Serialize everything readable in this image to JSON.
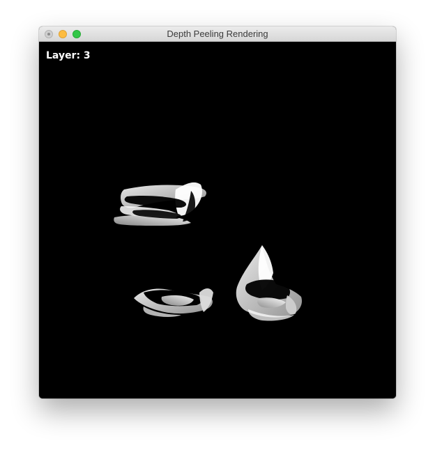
{
  "window": {
    "title": "Depth Peeling Rendering"
  },
  "controls": {
    "close_icon": "close-icon",
    "minimize_icon": "minimize-icon",
    "zoom_icon": "zoom-icon"
  },
  "viewport": {
    "layer_label": "Layer: 3",
    "background": "#000000",
    "render_color": "#e0e0e0"
  }
}
